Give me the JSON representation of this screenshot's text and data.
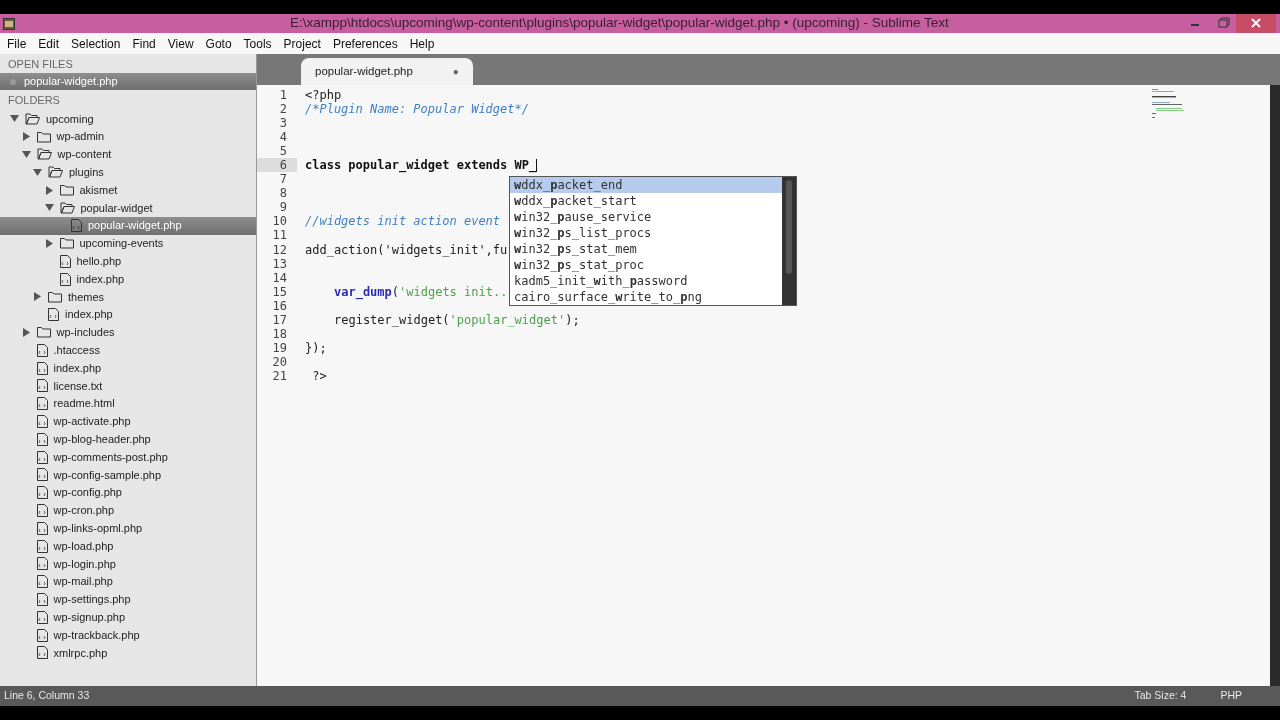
{
  "window": {
    "title": "E:\\xampp\\htdocs\\upcoming\\wp-content\\plugins\\popular-widget\\popular-widget.php • (upcoming) - Sublime Text"
  },
  "menu": [
    "File",
    "Edit",
    "Selection",
    "Find",
    "View",
    "Goto",
    "Tools",
    "Project",
    "Preferences",
    "Help"
  ],
  "sidebar": {
    "open_files_title": "OPEN FILES",
    "open_files": [
      {
        "name": "popular-widget.php",
        "selected": true
      }
    ],
    "folders_title": "FOLDERS",
    "tree": [
      {
        "name": "upcoming",
        "kind": "folder",
        "expanded": true,
        "selected": false,
        "children": [
          {
            "name": "wp-admin",
            "kind": "folder",
            "expanded": false,
            "selected": false
          },
          {
            "name": "wp-content",
            "kind": "folder",
            "expanded": true,
            "selected": false,
            "children": [
              {
                "name": "plugins",
                "kind": "folder",
                "expanded": true,
                "selected": false,
                "children": [
                  {
                    "name": "akismet",
                    "kind": "folder",
                    "expanded": false,
                    "selected": false
                  },
                  {
                    "name": "popular-widget",
                    "kind": "folder",
                    "expanded": true,
                    "selected": false,
                    "children": [
                      {
                        "name": "popular-widget.php",
                        "kind": "file",
                        "selected": true
                      }
                    ]
                  },
                  {
                    "name": "upcoming-events",
                    "kind": "folder",
                    "expanded": false,
                    "selected": false
                  },
                  {
                    "name": "hello.php",
                    "kind": "file",
                    "selected": false
                  },
                  {
                    "name": "index.php",
                    "kind": "file",
                    "selected": false
                  }
                ]
              },
              {
                "name": "themes",
                "kind": "folder",
                "expanded": false,
                "selected": false
              },
              {
                "name": "index.php",
                "kind": "file",
                "selected": false
              }
            ]
          },
          {
            "name": "wp-includes",
            "kind": "folder",
            "expanded": false,
            "selected": false
          },
          {
            "name": ".htaccess",
            "kind": "file",
            "selected": false
          },
          {
            "name": "index.php",
            "kind": "file",
            "selected": false
          },
          {
            "name": "license.txt",
            "kind": "file",
            "selected": false
          },
          {
            "name": "readme.html",
            "kind": "file",
            "selected": false
          },
          {
            "name": "wp-activate.php",
            "kind": "file",
            "selected": false
          },
          {
            "name": "wp-blog-header.php",
            "kind": "file",
            "selected": false
          },
          {
            "name": "wp-comments-post.php",
            "kind": "file",
            "selected": false
          },
          {
            "name": "wp-config-sample.php",
            "kind": "file",
            "selected": false
          },
          {
            "name": "wp-config.php",
            "kind": "file",
            "selected": false
          },
          {
            "name": "wp-cron.php",
            "kind": "file",
            "selected": false
          },
          {
            "name": "wp-links-opml.php",
            "kind": "file",
            "selected": false
          },
          {
            "name": "wp-load.php",
            "kind": "file",
            "selected": false
          },
          {
            "name": "wp-login.php",
            "kind": "file",
            "selected": false
          },
          {
            "name": "wp-mail.php",
            "kind": "file",
            "selected": false
          },
          {
            "name": "wp-settings.php",
            "kind": "file",
            "selected": false
          },
          {
            "name": "wp-signup.php",
            "kind": "file",
            "selected": false
          },
          {
            "name": "wp-trackback.php",
            "kind": "file",
            "selected": false
          },
          {
            "name": "xmlrpc.php",
            "kind": "file",
            "selected": false
          }
        ]
      }
    ]
  },
  "tabs": [
    {
      "label": "popular-widget.php",
      "selected": true,
      "modified_mark": "●"
    }
  ],
  "editor": {
    "lines": [
      {
        "number": "1",
        "current": false,
        "tokens": [
          {
            "text": "<?php",
            "kind": "plain"
          }
        ]
      },
      {
        "number": "2",
        "current": false,
        "tokens": [
          {
            "text": "/*Plugin Name: Popular Widget*/",
            "kind": "comment"
          }
        ]
      },
      {
        "number": "3",
        "current": false
      },
      {
        "number": "4",
        "current": false
      },
      {
        "number": "5",
        "current": false
      },
      {
        "number": "6",
        "current": true,
        "tokens": [
          {
            "text": "class popular_widget extends WP_",
            "kind": "bold"
          }
        ]
      },
      {
        "number": "7",
        "current": false
      },
      {
        "number": "8",
        "current": false
      },
      {
        "number": "9",
        "current": false
      },
      {
        "number": "10",
        "current": false,
        "tokens": [
          {
            "text": "//widgets init action event",
            "kind": "comment"
          }
        ]
      },
      {
        "number": "11",
        "current": false
      },
      {
        "number": "12",
        "current": false,
        "tokens": [
          {
            "text": "add_action('widgets_init',fu",
            "kind": "plain"
          }
        ]
      },
      {
        "number": "13",
        "current": false
      },
      {
        "number": "14",
        "current": false
      },
      {
        "number": "15",
        "current": false,
        "indented": true,
        "tokens": [
          {
            "text": "var_dump",
            "kind": "function"
          },
          {
            "text": "(",
            "kind": "plain"
          },
          {
            "text": "'widgets init..",
            "kind": "string"
          }
        ]
      },
      {
        "number": "16",
        "current": false
      },
      {
        "number": "17",
        "current": false,
        "indented": true,
        "tokens": [
          {
            "text": "register_widget(",
            "kind": "plain"
          },
          {
            "text": "'popular_widget'",
            "kind": "string"
          },
          {
            "text": ");",
            "kind": "plain"
          }
        ]
      },
      {
        "number": "18",
        "current": false
      },
      {
        "number": "19",
        "current": false,
        "tokens": [
          {
            "text": "});",
            "kind": "plain"
          }
        ]
      },
      {
        "number": "20",
        "current": false
      },
      {
        "number": "21",
        "current": false,
        "tokens": [
          {
            "text": " ?>",
            "kind": "plain"
          }
        ]
      }
    ],
    "completions": [
      {
        "text": "**w**ddx_**p**acket_end",
        "selected": true
      },
      {
        "text": "**w**ddx_**p**acket_start",
        "selected": false
      },
      {
        "text": "**w**in32_**p**ause_service",
        "selected": false
      },
      {
        "text": "**w**in32_**p**s_list_procs",
        "selected": false
      },
      {
        "text": "**w**in32_**p**s_stat_mem",
        "selected": false
      },
      {
        "text": "**w**in32_**p**s_stat_proc",
        "selected": false
      },
      {
        "text": "kadm5_init_**w**ith_**p**assword",
        "selected": false
      },
      {
        "text": "cairo_surface_**w**rite_to_**p**ng",
        "selected": false
      }
    ]
  },
  "status_bar": {
    "position": "Line 6, Column 33",
    "tab_size": "Tab Size: 4",
    "syntax": "PHP"
  }
}
